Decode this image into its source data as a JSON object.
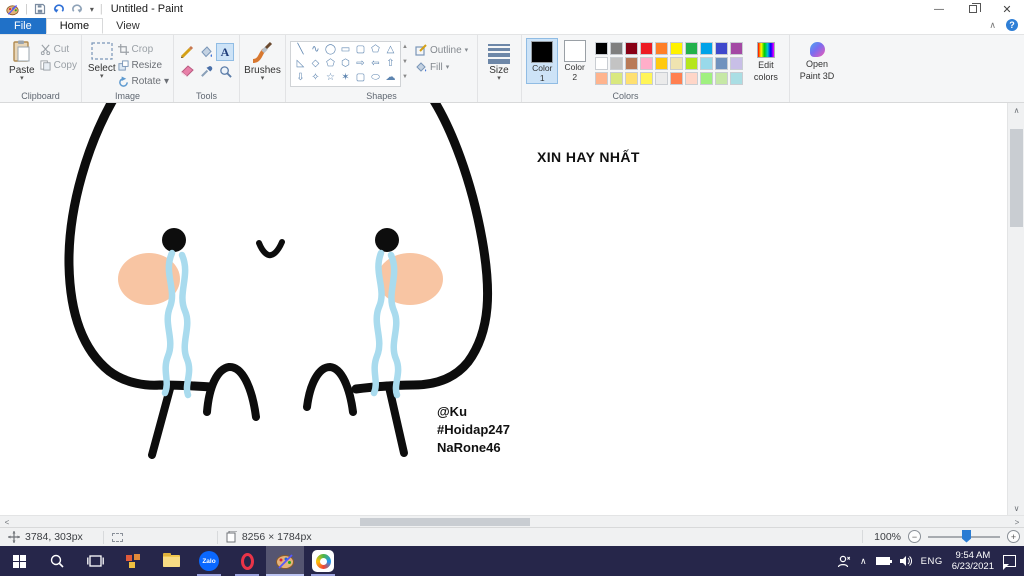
{
  "titlebar": {
    "title": "Untitled - Paint"
  },
  "tabs": {
    "file": "File",
    "home": "Home",
    "view": "View"
  },
  "ribbon": {
    "clipboard": {
      "label": "Clipboard",
      "paste": "Paste",
      "cut": "Cut",
      "copy": "Copy"
    },
    "image": {
      "label": "Image",
      "select": "Select",
      "crop": "Crop",
      "resize": "Resize",
      "rotate": "Rotate"
    },
    "tools": {
      "label": "Tools",
      "text_glyph": "A"
    },
    "brushes": {
      "label": "Brushes"
    },
    "shapes": {
      "label": "Shapes",
      "outline": "Outline",
      "fill": "Fill",
      "glyphs": [
        "╲",
        "∿",
        "◯",
        "▭",
        "▢",
        "⬠",
        "△",
        "◺",
        "◇",
        "⬠",
        "⬡",
        "⇨",
        "⇦",
        "⇧",
        "⇩",
        "✧",
        "☆",
        "✶",
        "▢",
        "⬭",
        "☁"
      ]
    },
    "size": {
      "label": "Size"
    },
    "colors": {
      "label": "Colors",
      "color1_label": "Color",
      "color1_num": "1",
      "color1": "#000000",
      "color2_label": "Color",
      "color2_num": "2",
      "color2": "#ffffff",
      "edit_line1": "Edit",
      "edit_line2": "colors",
      "palette": [
        "#000000",
        "#7f7f7f",
        "#880015",
        "#ed1c24",
        "#ff7f27",
        "#fff200",
        "#22b14c",
        "#00a2e8",
        "#3f48cc",
        "#a349a4",
        "#ffffff",
        "#c3c3c3",
        "#b97a57",
        "#ffaec9",
        "#ffc90e",
        "#efe4b0",
        "#b5e61d",
        "#99d9ea",
        "#7092be",
        "#c8bfe7",
        "#ffb48e",
        "#d9e87f",
        "#ffe070",
        "#fff558",
        "#ebebeb",
        "#ff7f50",
        "#ffd6c8",
        "#a0f080",
        "#c6e8a6",
        "#aadee4"
      ]
    },
    "paint3d": {
      "line1": "Open",
      "line2": "Paint 3D"
    }
  },
  "canvas": {
    "caption": "XIN HAY NHẤT",
    "signature": [
      "@Ku",
      "#Hoidap247",
      "NaRone46"
    ],
    "ink_color": "#0d0d0d",
    "tear_color": "#a9dbee",
    "cheek_color": "#f8c5a3"
  },
  "statusbar": {
    "cursor": "3784, 303px",
    "dimensions": "8256 × 1784px",
    "zoom": "100%"
  },
  "taskbar": {
    "zalo": "Zalo",
    "lang": "ENG",
    "time": "9:54 AM",
    "date": "6/23/2021"
  }
}
